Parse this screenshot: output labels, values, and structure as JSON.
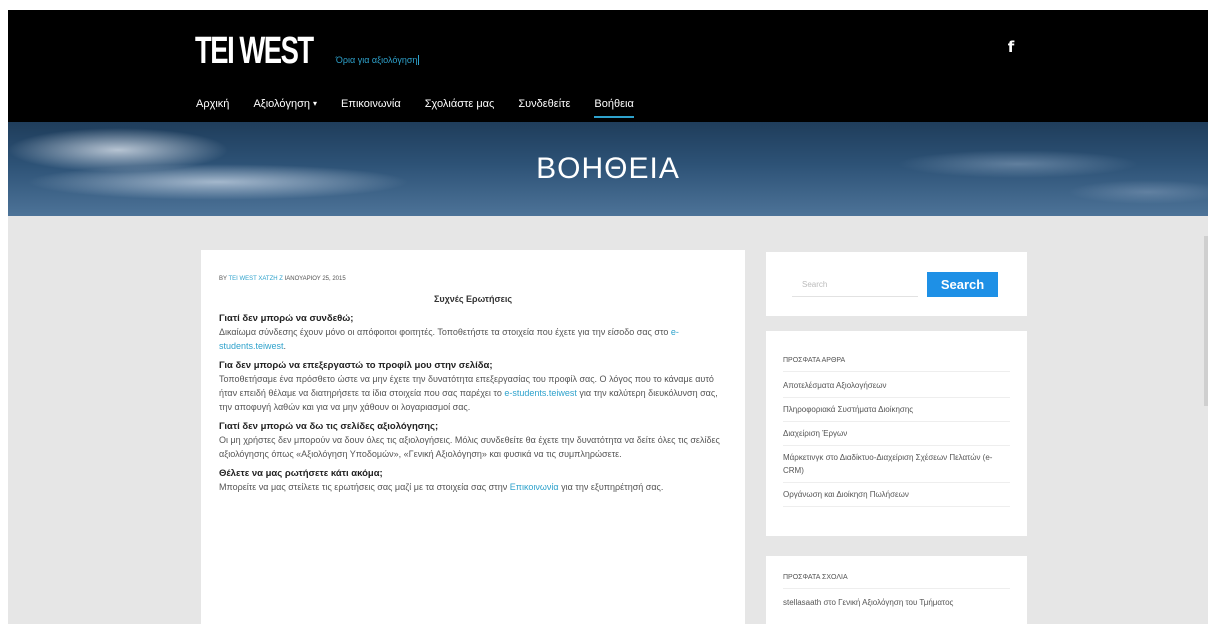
{
  "header": {
    "site_title": "TEI WEST",
    "tagline": "Όρια για αξιολόγηση",
    "facebook_icon": "f"
  },
  "nav": {
    "items": [
      {
        "label": "Αρχική"
      },
      {
        "label": "Αξιολόγηση",
        "has_dropdown": true
      },
      {
        "label": "Επικοινωνία"
      },
      {
        "label": "Σχολιάστε μας"
      },
      {
        "label": "Συνδεθείτε"
      },
      {
        "label": "Βοήθεια",
        "active": true
      }
    ],
    "dropdown_caret": "▾"
  },
  "hero": {
    "title": "ΒΟΗΘΕΙΑ"
  },
  "post": {
    "meta_prefix": "BY",
    "author": "TEI WEST ΧΑΤΖΗ Ζ",
    "date": "ΙΑΝΟΥΑΡΙΟΥ 25, 2015",
    "faq_heading": "Συχνές Ερωτήσεις",
    "faqs": [
      {
        "question": "Γιατί δεν μπορώ να συνδεθώ;",
        "answer_before": "Δικαίωμα σύνδεσης έχουν μόνο οι απόφοιτοι φοιτητές. Τοποθετήστε τα στοιχεία που έχετε για την είσοδο σας στο ",
        "link": "e-students.teiwest",
        "answer_after": "."
      },
      {
        "question": "Για δεν μπορώ να επεξεργαστώ το προφίλ μου στην σελίδα;",
        "answer_before": "Τοποθετήσαμε ένα πρόσθετο ώστε να μην έχετε την δυνατότητα επεξεργασίας του προφίλ σας. Ο λόγος που το κάναμε αυτό ήταν επειδή θέλαμε να διατηρήσετε τα ίδια στοιχεία που σας παρέχει το ",
        "link": "e-students.teiwest",
        "answer_after": " για την καλύτερη διευκόλυνση σας, την αποφυγή λαθών και για να μην χάθουν οι λογαριασμοί σας."
      },
      {
        "question": "Γιατί δεν μπορώ να δω τις σελίδες αξιολόγησης;",
        "answer_before": "Οι μη χρήστες δεν μπορούν να δουν όλες τις αξιολογήσεις. Μόλις συνδεθείτε θα έχετε την δυνατότητα να δείτε όλες τις σελίδες αξιολόγησης όπως «Αξιολόγηση Υποδομών», «Γενική Αξιολόγηση» και φυσικά να τις συμπληρώσετε.",
        "link": "",
        "answer_after": ""
      },
      {
        "question": "Θέλετε να μας ρωτήσετε κάτι ακόμα;",
        "answer_before": "Μπορείτε να μας στείλετε τις ερωτήσεις σας μαζί με τα στοιχεία σας στην ",
        "link": "Επικοινωνία",
        "answer_after": " για την εξυπηρέτησή σας."
      }
    ]
  },
  "sidebar": {
    "search": {
      "placeholder": "Search",
      "button_label": "Search"
    },
    "recent_posts": {
      "title": "ΠΡΟΣΦΑΤΑ ΑΡΘΡΑ",
      "items": [
        "Αποτελέσματα Αξιολογήσεων",
        "Πληροφοριακά Συστήματα Διοίκησης",
        "Διαχείριση Έργων",
        "Μάρκετινγκ στο Διαδίκτυο-Διαχείριση Σχέσεων Πελατών (e-CRM)",
        "Οργάνωση και Διοίκηση Πωλήσεων"
      ]
    },
    "recent_comments": {
      "title": "ΠΡΟΣΦΑΤΑ ΣΧΟΛΙΑ",
      "items": [
        "stellasaath στο Γενική Αξιολόγηση του Τμήματος"
      ]
    }
  }
}
